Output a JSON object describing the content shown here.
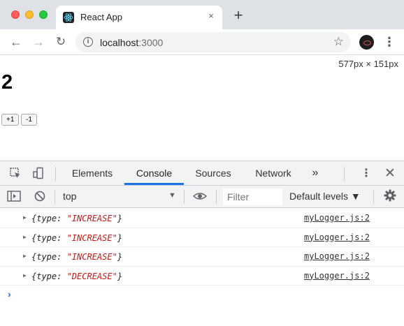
{
  "browser": {
    "tab_title": "React App",
    "tab_close": "×",
    "new_tab": "+",
    "url_host": "localhost",
    "url_port": ":3000"
  },
  "page": {
    "dimensions": "577px × 151px",
    "count": "2",
    "increment_label": "+1",
    "decrement_label": "-1"
  },
  "devtools": {
    "tabs": [
      "Elements",
      "Console",
      "Sources",
      "Network"
    ],
    "active_tab": "Console",
    "more_tabs": "»",
    "context": "top",
    "filter_placeholder": "Filter",
    "levels": "Default levels ▼",
    "logs": [
      {
        "prefix": "{type: ",
        "value": "\"INCREASE\"",
        "suffix": "}",
        "source": "myLogger.js:2"
      },
      {
        "prefix": "{type: ",
        "value": "\"INCREASE\"",
        "suffix": "}",
        "source": "myLogger.js:2"
      },
      {
        "prefix": "{type: ",
        "value": "\"INCREASE\"",
        "suffix": "}",
        "source": "myLogger.js:2"
      },
      {
        "prefix": "{type: ",
        "value": "\"DECREASE\"",
        "suffix": "}",
        "source": "myLogger.js:2"
      }
    ],
    "prompt": "›"
  },
  "colors": {
    "accent": "#1a73e8",
    "string": "#c41a16"
  }
}
